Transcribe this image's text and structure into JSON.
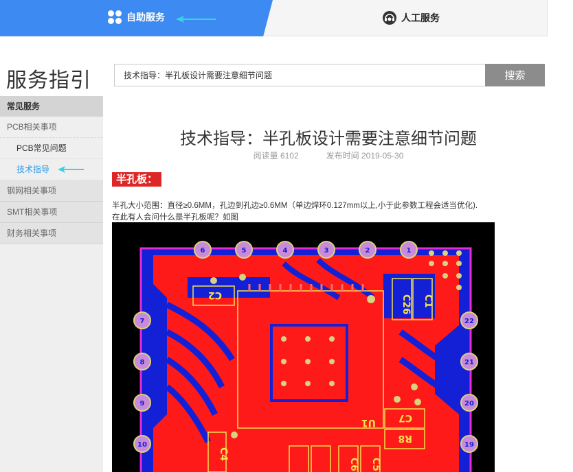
{
  "tabs": {
    "self_service": "自助服务",
    "human_service": "人工服务"
  },
  "page": {
    "title": "服务指引"
  },
  "search": {
    "value": "技术指导：半孔板设计需要注意细节问题",
    "button": "搜索"
  },
  "sidebar": {
    "header": "常见服务",
    "items": [
      {
        "label": "PCB相关事项"
      },
      {
        "label": "PCB常见问题"
      },
      {
        "label": "技术指导"
      },
      {
        "label": "钢网相关事项"
      },
      {
        "label": "SMT相关事项"
      },
      {
        "label": "财务相关事项"
      }
    ]
  },
  "article": {
    "title": "技术指导：半孔板设计需要注意细节问题",
    "views": "阅读量 6102",
    "published": "发布时间 2019-05-30",
    "section": "半孔板：",
    "para1": "半孔大小范围：直径≥0.6MM，孔边到孔边≥0.6MM（单边焊环0.127mm以上,小于此参数工程会适当优化).",
    "para2": "在此有人会问什么是半孔板呢？如图"
  },
  "pcb": {
    "pins_top": [
      "6",
      "5",
      "4",
      "3",
      "2",
      "1"
    ],
    "pins_left": [
      "7",
      "8",
      "9",
      "10"
    ],
    "pins_right": [
      "22",
      "21",
      "20",
      "19"
    ],
    "labels": [
      "C2",
      "C26",
      "C1",
      "U1",
      "C7",
      "R8",
      "C4",
      "C6",
      "C5"
    ]
  },
  "colors": {
    "accent": "#3d8bf2",
    "active_link": "#2f9de6",
    "section_tag": "#dd2727",
    "pcb_red": "#ff1a1a",
    "pcb_blue": "#1420d6",
    "pcb_magenta": "#e62ad8"
  }
}
